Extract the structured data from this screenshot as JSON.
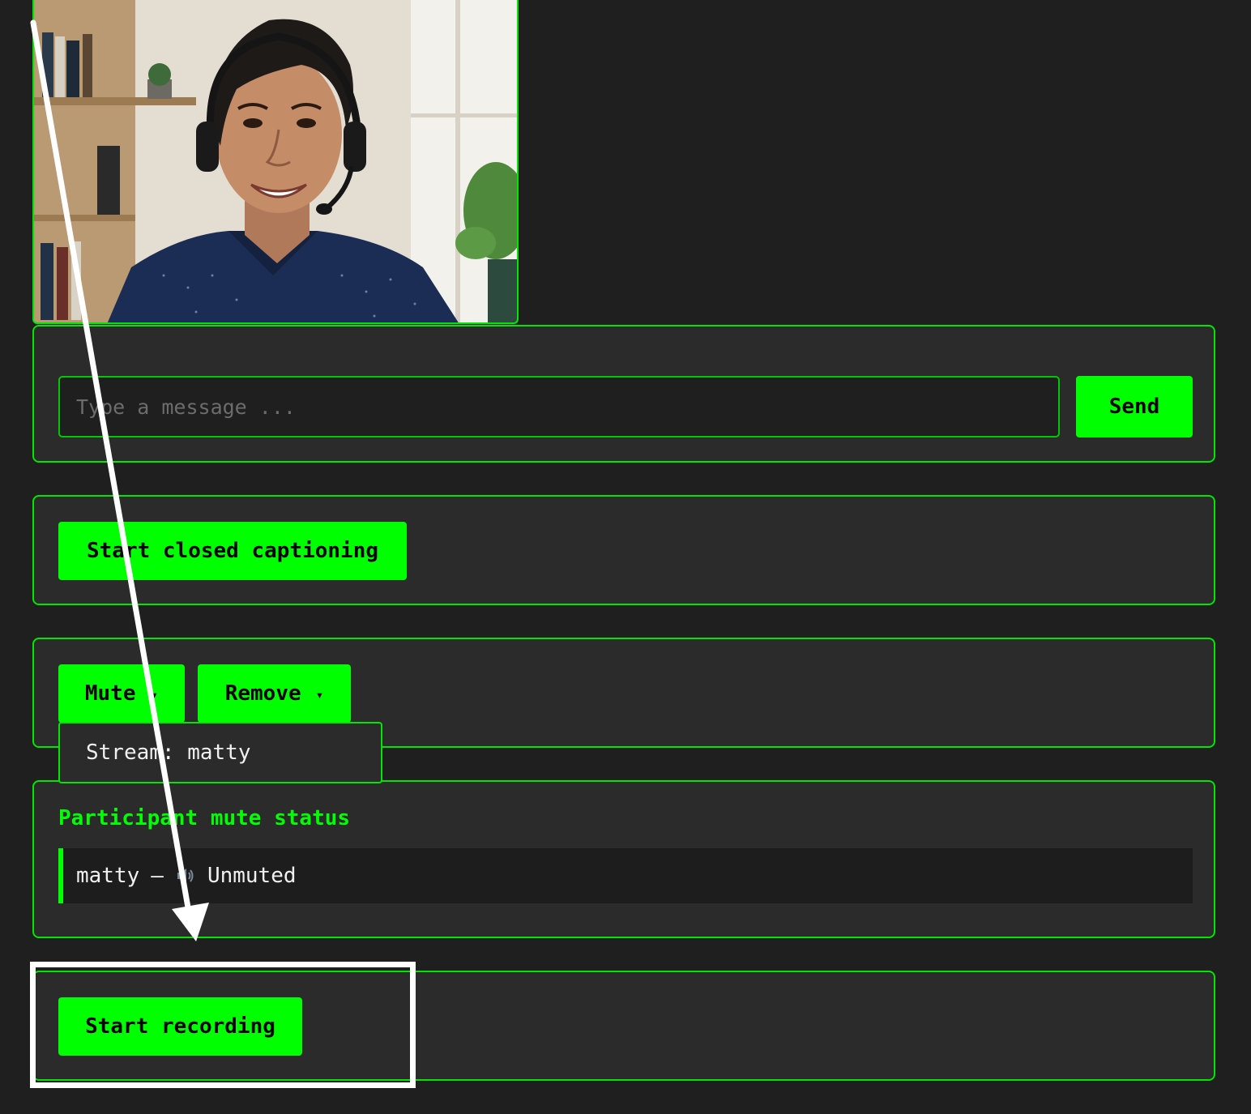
{
  "video": {
    "participant_image": "woman-with-headset-portrait"
  },
  "chat": {
    "placeholder": "Type a message ...",
    "value": "",
    "send_label": "Send"
  },
  "captions": {
    "button_label": "Start closed captioning"
  },
  "moderation": {
    "mute_label": "Mute",
    "remove_label": "Remove",
    "caret": "▾",
    "dropdown_item": "Stream: matty"
  },
  "mute_status": {
    "title": "Participant mute status",
    "participants": [
      {
        "name": "matty",
        "separator": "—",
        "icon": "speaker-icon",
        "status": "Unmuted"
      }
    ]
  },
  "recording": {
    "button_label": "Start recording"
  },
  "colors": {
    "accent": "#00ff00",
    "panel_bg": "#2b2b2b",
    "page_bg": "#1f1f1f",
    "annotation": "#ffffff"
  }
}
